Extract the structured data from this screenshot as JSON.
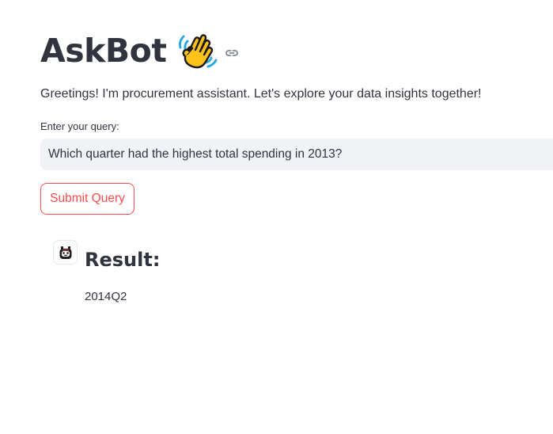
{
  "header": {
    "title": "AskBot",
    "title_emoji": "waving-hand-icon",
    "anchor_icon": "link-icon"
  },
  "greeting": "Greetings! I'm procurement assistant. Let's explore your data insights together!",
  "query": {
    "label": "Enter your query:",
    "value": "Which quarter had the highest total spending in 2013?"
  },
  "submit": {
    "label": "Submit Query"
  },
  "chat": {
    "avatar_icon": "bot-avatar-icon",
    "result_heading": "Result:",
    "result_value": "2014Q2"
  },
  "colors": {
    "accent": "#ff4b4b",
    "text": "#31333f",
    "input_background": "#f0f2f6"
  }
}
